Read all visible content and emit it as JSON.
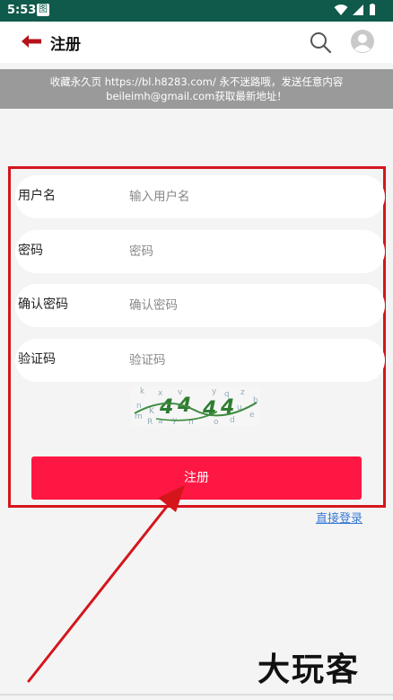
{
  "status_bar": {
    "time": "5:53"
  },
  "header": {
    "title": "注册"
  },
  "notice": {
    "line1": "收藏永久页 https://bl.h8283.com/ 永不迷路哦，发送任意内容",
    "line2": "beileimh@gmail.com获取最新地址！"
  },
  "form": {
    "username": {
      "label": "用户名",
      "placeholder": "输入用户名",
      "value": ""
    },
    "password": {
      "label": "密码",
      "placeholder": "密码",
      "value": ""
    },
    "confirm_password": {
      "label": "确认密码",
      "placeholder": "确认密码",
      "value": ""
    },
    "captcha": {
      "label": "验证码",
      "placeholder": "验证码",
      "value": ""
    }
  },
  "submit_label": "注册",
  "login_link": "直接登录",
  "watermark": "大玩客",
  "colors": {
    "status_bar": "#0f5a4a",
    "accent": "#ff1744",
    "highlight_frame": "#d4161c",
    "link": "#3a7bd5"
  }
}
